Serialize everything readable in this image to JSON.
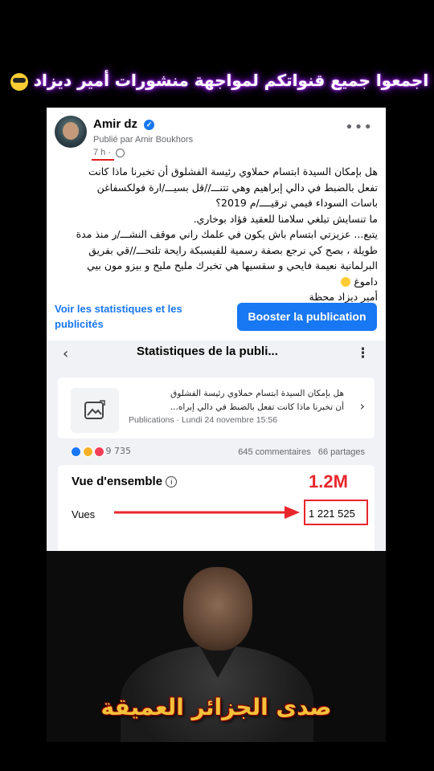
{
  "top_caption": "اجمعوا جميع قنواتكم لمواجهة منشورات أمير ديزاد",
  "top_caption_emoji": "sunglasses-emoji",
  "post": {
    "author": "Amir dz",
    "published_by": "Publié par Amir Boukhors",
    "time": "7 h ·",
    "text": "هل بإمكان  السيدة ابتسام حملاوي رئيسة الفشلوق أن تخبرنا ماذا كانت\nتفعل بالضبط في دالي إبراهيم وهي تتنـــ//قل بسيـــ/ارة فولكسفاغن\nباسات السوداء فيمي ترقيــــ/م 2019؟\nما تنسايش تبلغي سلامنا للعقيد فؤاد بوخاري.\nيتبع... عزيزتي ابتسام باش يكون في علمك راني موقف النشـــ/ر منذ مدة\nطويلة ، بصح كي نرجع بصفة رسمية للفيسبكة  رايحة تلتحـــ//قي بفريق\nالبرلمانية نعيمة فايحي و سقسيها هي تخبرك مليح مليح و بيزو مون بيي\nداموغ",
    "signature": "أمير ديزاد محظة",
    "stats_link": "Voir les statistiques et les publicités",
    "boost_button": "Booster la publication"
  },
  "stats": {
    "title": "Statistiques de la publi...",
    "preview_line1": "هل بإمكان  السيدة ابتسام حملاوي رئيسة الفشلوق",
    "preview_line2": "أن تخبرنا ماذا كانت تفعل بالضبط في دالي إبراه...",
    "preview_meta": "Publications · Lundi 24 novembre 15:56",
    "reactions_count": "9 735",
    "comments": "645 commentaires",
    "shares": "66 partages",
    "overview_title": "Vue d'ensemble",
    "views_label": "Vues",
    "views_value": "1 221 525",
    "annotation": "1.2M"
  },
  "photo_caption": "صدى الجزائر العميقة",
  "colors": {
    "facebook_blue": "#1877f2",
    "annotation_red": "#e8262b",
    "caption_glow": "#8a00ff",
    "caption_gold": "#f2c23a"
  }
}
